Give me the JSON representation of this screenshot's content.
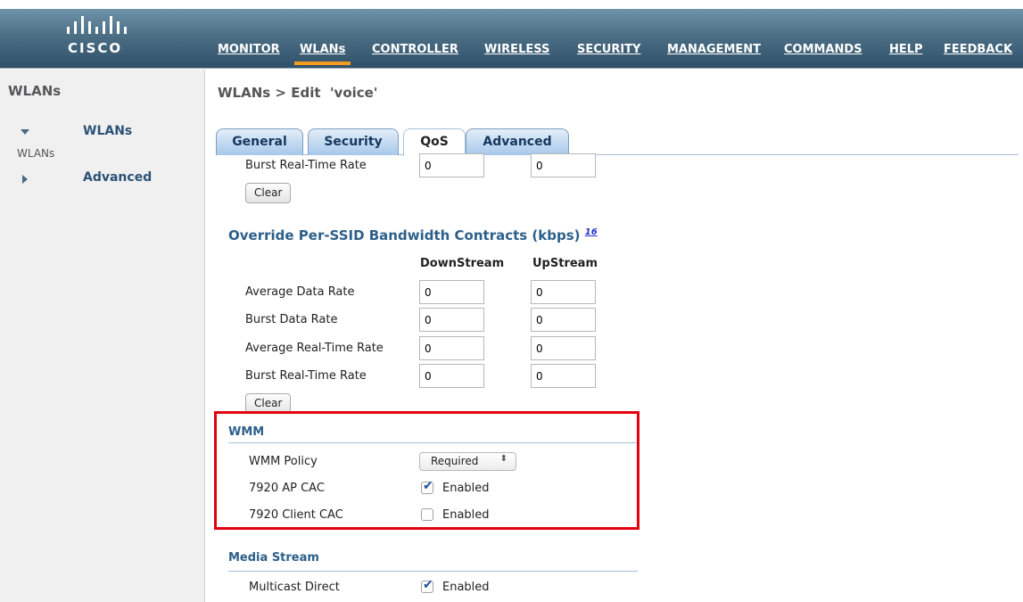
{
  "brand": {
    "logo_text": "CISCO",
    "logo_icon": "cisco-bridge-icon"
  },
  "nav": {
    "items": [
      "MONITOR",
      "WLANs",
      "CONTROLLER",
      "WIRELESS",
      "SECURITY",
      "MANAGEMENT",
      "COMMANDS",
      "HELP",
      "FEEDBACK"
    ],
    "active": "WLANs"
  },
  "sidebar": {
    "title": "WLANs",
    "items": [
      {
        "label": "WLANs",
        "expanded": true,
        "icon": "triangle-down-icon",
        "sub": "WLANs"
      },
      {
        "label": "Advanced",
        "expanded": false,
        "icon": "triangle-right-icon"
      }
    ]
  },
  "page": {
    "title": "WLANs > Edit  'voice'"
  },
  "tabs": [
    "General",
    "Security",
    "QoS",
    "Advanced"
  ],
  "active_tab": "QoS",
  "top_partial": {
    "label": "Burst Real-Time Rate",
    "downstream": "0",
    "upstream": "0",
    "clear_label": "Clear"
  },
  "override_ssid": {
    "heading": "Override Per-SSID Bandwidth Contracts (kbps)",
    "footnote": "16",
    "col_down": "DownStream",
    "col_up": "UpStream",
    "rows": [
      {
        "label": "Average Data Rate",
        "down": "0",
        "up": "0"
      },
      {
        "label": "Burst Data Rate",
        "down": "0",
        "up": "0"
      },
      {
        "label": "Average Real-Time Rate",
        "down": "0",
        "up": "0"
      },
      {
        "label": "Burst Real-Time Rate",
        "down": "0",
        "up": "0"
      }
    ],
    "clear_label": "Clear"
  },
  "wmm": {
    "heading": "WMM",
    "policy_label": "WMM Policy",
    "policy_value": "Required",
    "ap_cac_label": "7920 AP CAC",
    "ap_cac_checked": true,
    "ap_cac_text": "Enabled",
    "client_cac_label": "7920 Client CAC",
    "client_cac_checked": false,
    "client_cac_text": "Enabled"
  },
  "media_stream": {
    "heading": "Media Stream",
    "multicast_label": "Multicast Direct",
    "multicast_checked": true,
    "multicast_text": "Enabled"
  },
  "colors": {
    "highlight": "#e2000f",
    "accent": "#f39c1f",
    "heading": "#2c5f8a"
  }
}
